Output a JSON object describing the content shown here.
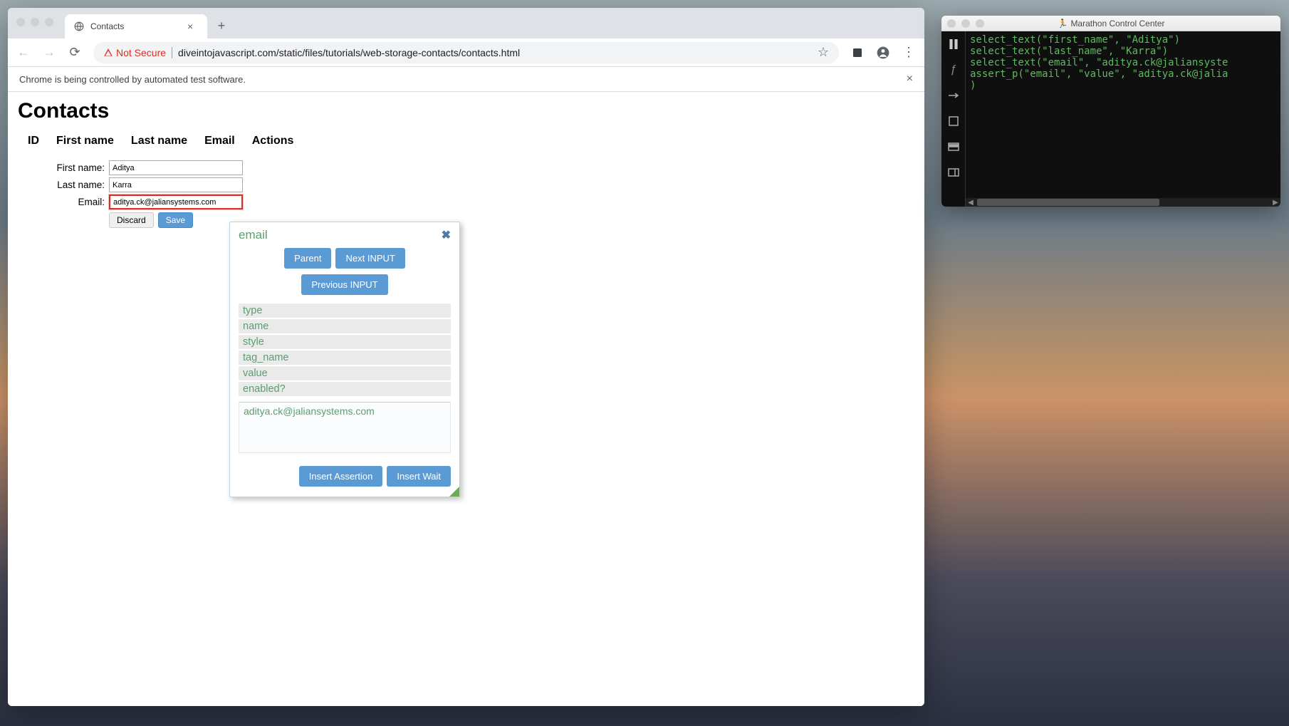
{
  "browser": {
    "tab_title": "Contacts",
    "address": "diveintojavascript.com/static/files/tutorials/web-storage-contacts/contacts.html",
    "security_label": "Not Secure",
    "infobar": "Chrome is being controlled by automated test software."
  },
  "page": {
    "title": "Contacts",
    "columns": [
      "ID",
      "First name",
      "Last name",
      "Email",
      "Actions"
    ],
    "form": {
      "first_name_label": "First name:",
      "first_name_value": "Aditya",
      "last_name_label": "Last name:",
      "last_name_value": "Karra",
      "email_label": "Email:",
      "email_value": "aditya.ck@jaliansystems.com",
      "discard": "Discard",
      "save": "Save"
    }
  },
  "assert_popup": {
    "title": "email",
    "parent": "Parent",
    "next_input": "Next INPUT",
    "prev_input": "Previous INPUT",
    "properties": [
      "type",
      "name",
      "style",
      "tag_name",
      "value",
      "enabled?"
    ],
    "value_display": "aditya.ck@jaliansystems.com",
    "insert_assertion": "Insert Assertion",
    "insert_wait": "Insert Wait"
  },
  "marathon": {
    "title": "Marathon Control Center",
    "code_lines": [
      "select_text(\"first_name\", \"Aditya\")",
      "select_text(\"last_name\", \"Karra\")",
      "select_text(\"email\", \"aditya.ck@jaliansyste",
      "assert_p(\"email\", \"value\", \"aditya.ck@jalia",
      ")"
    ]
  }
}
